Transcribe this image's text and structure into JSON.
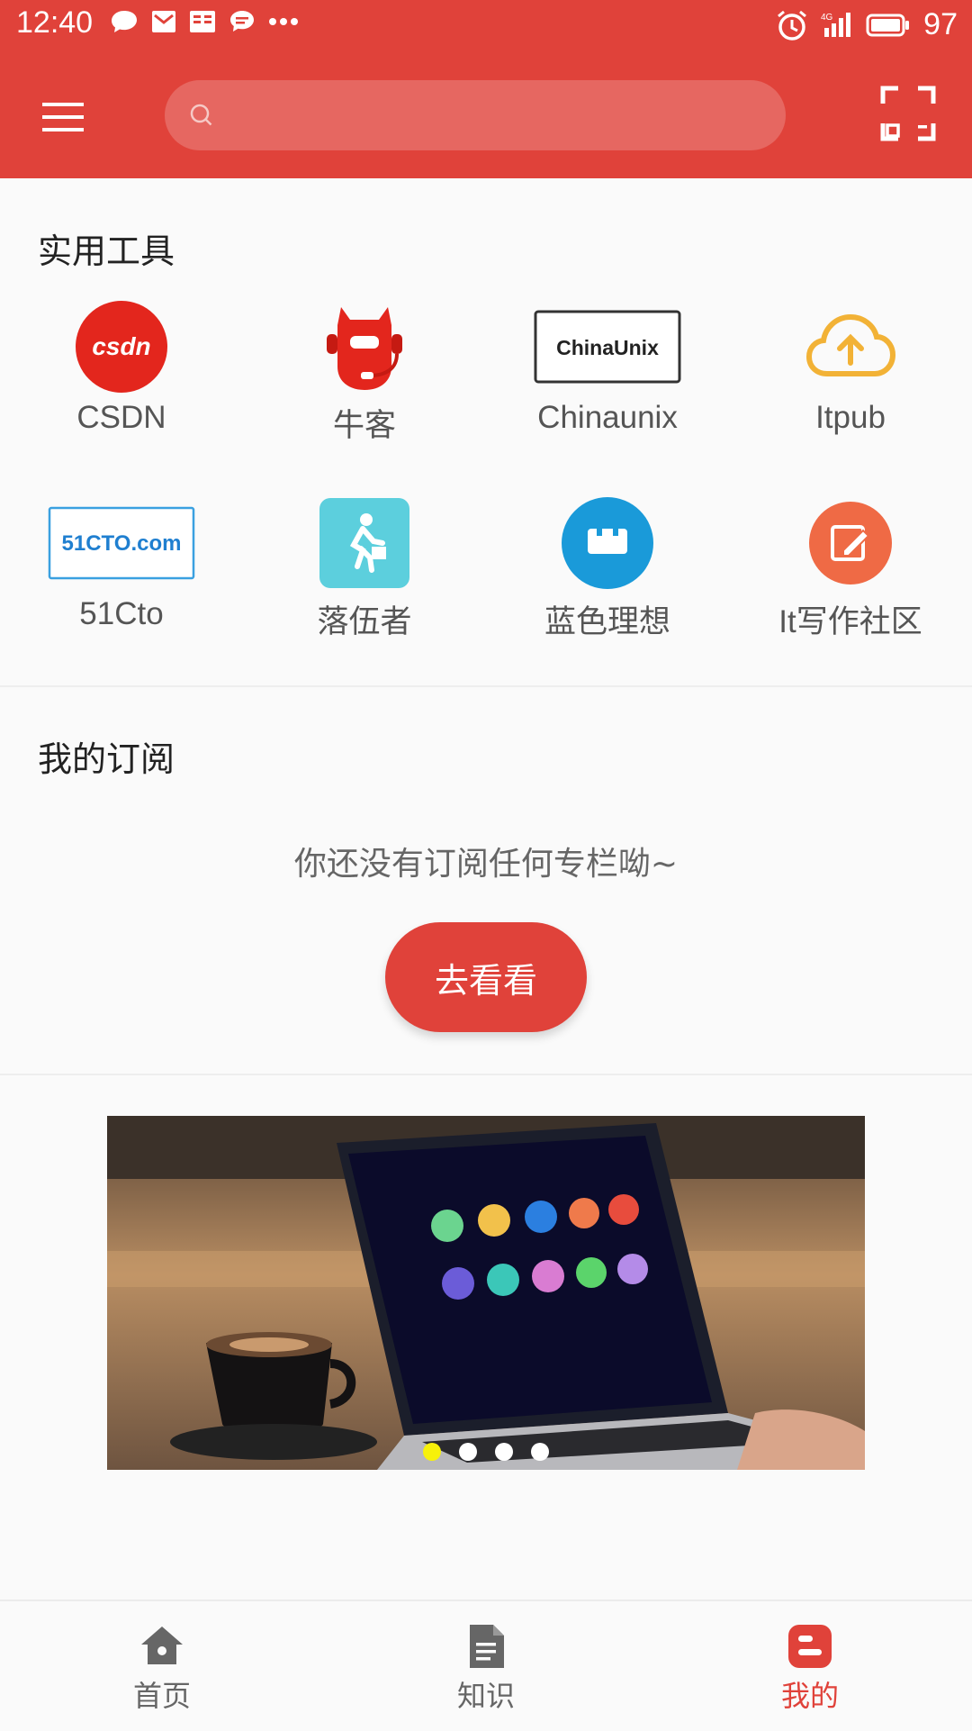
{
  "status_bar": {
    "time": "12:40",
    "battery": "97",
    "network": "4G",
    "left_icons": [
      "chat-bubble-icon",
      "mail-icon",
      "reader-icon",
      "message-icon",
      "more-dots-icon"
    ],
    "right_icons": [
      "alarm-icon",
      "signal-icon",
      "battery-icon"
    ]
  },
  "toolbar": {
    "menu_icon": "hamburger-menu-icon",
    "search": {
      "value": "",
      "placeholder": ""
    },
    "scan_icon": "scan-icon",
    "accent_color": "#e0423a"
  },
  "tools_section": {
    "title": "实用工具",
    "items": [
      {
        "label": "CSDN",
        "icon": "csdn-logo"
      },
      {
        "label": "牛客",
        "icon": "nowcoder-logo"
      },
      {
        "label": "Chinaunix",
        "icon": "chinaunix-logo",
        "logo_text": "ChinaUnix"
      },
      {
        "label": "Itpub",
        "icon": "itpub-cloud-upload-icon"
      },
      {
        "label": "51Cto",
        "icon": "51cto-logo",
        "logo_text": "51CTO.com"
      },
      {
        "label": "落伍者",
        "icon": "walker-icon"
      },
      {
        "label": "蓝色理想",
        "icon": "blueidea-icon"
      },
      {
        "label": "It写作社区",
        "icon": "edit-note-icon"
      }
    ]
  },
  "subscription_section": {
    "title": "我的订阅",
    "empty_text": "你还没有订阅任何专栏呦~",
    "button_label": "去看看"
  },
  "banner": {
    "slide_count": 4,
    "active_index": 0,
    "active_dot_color": "#f7f10a"
  },
  "bottom_nav": {
    "items": [
      {
        "label": "首页",
        "icon": "home-icon",
        "active": false
      },
      {
        "label": "知识",
        "icon": "document-icon",
        "active": false
      },
      {
        "label": "我的",
        "icon": "blogger-icon",
        "active": true
      }
    ]
  }
}
